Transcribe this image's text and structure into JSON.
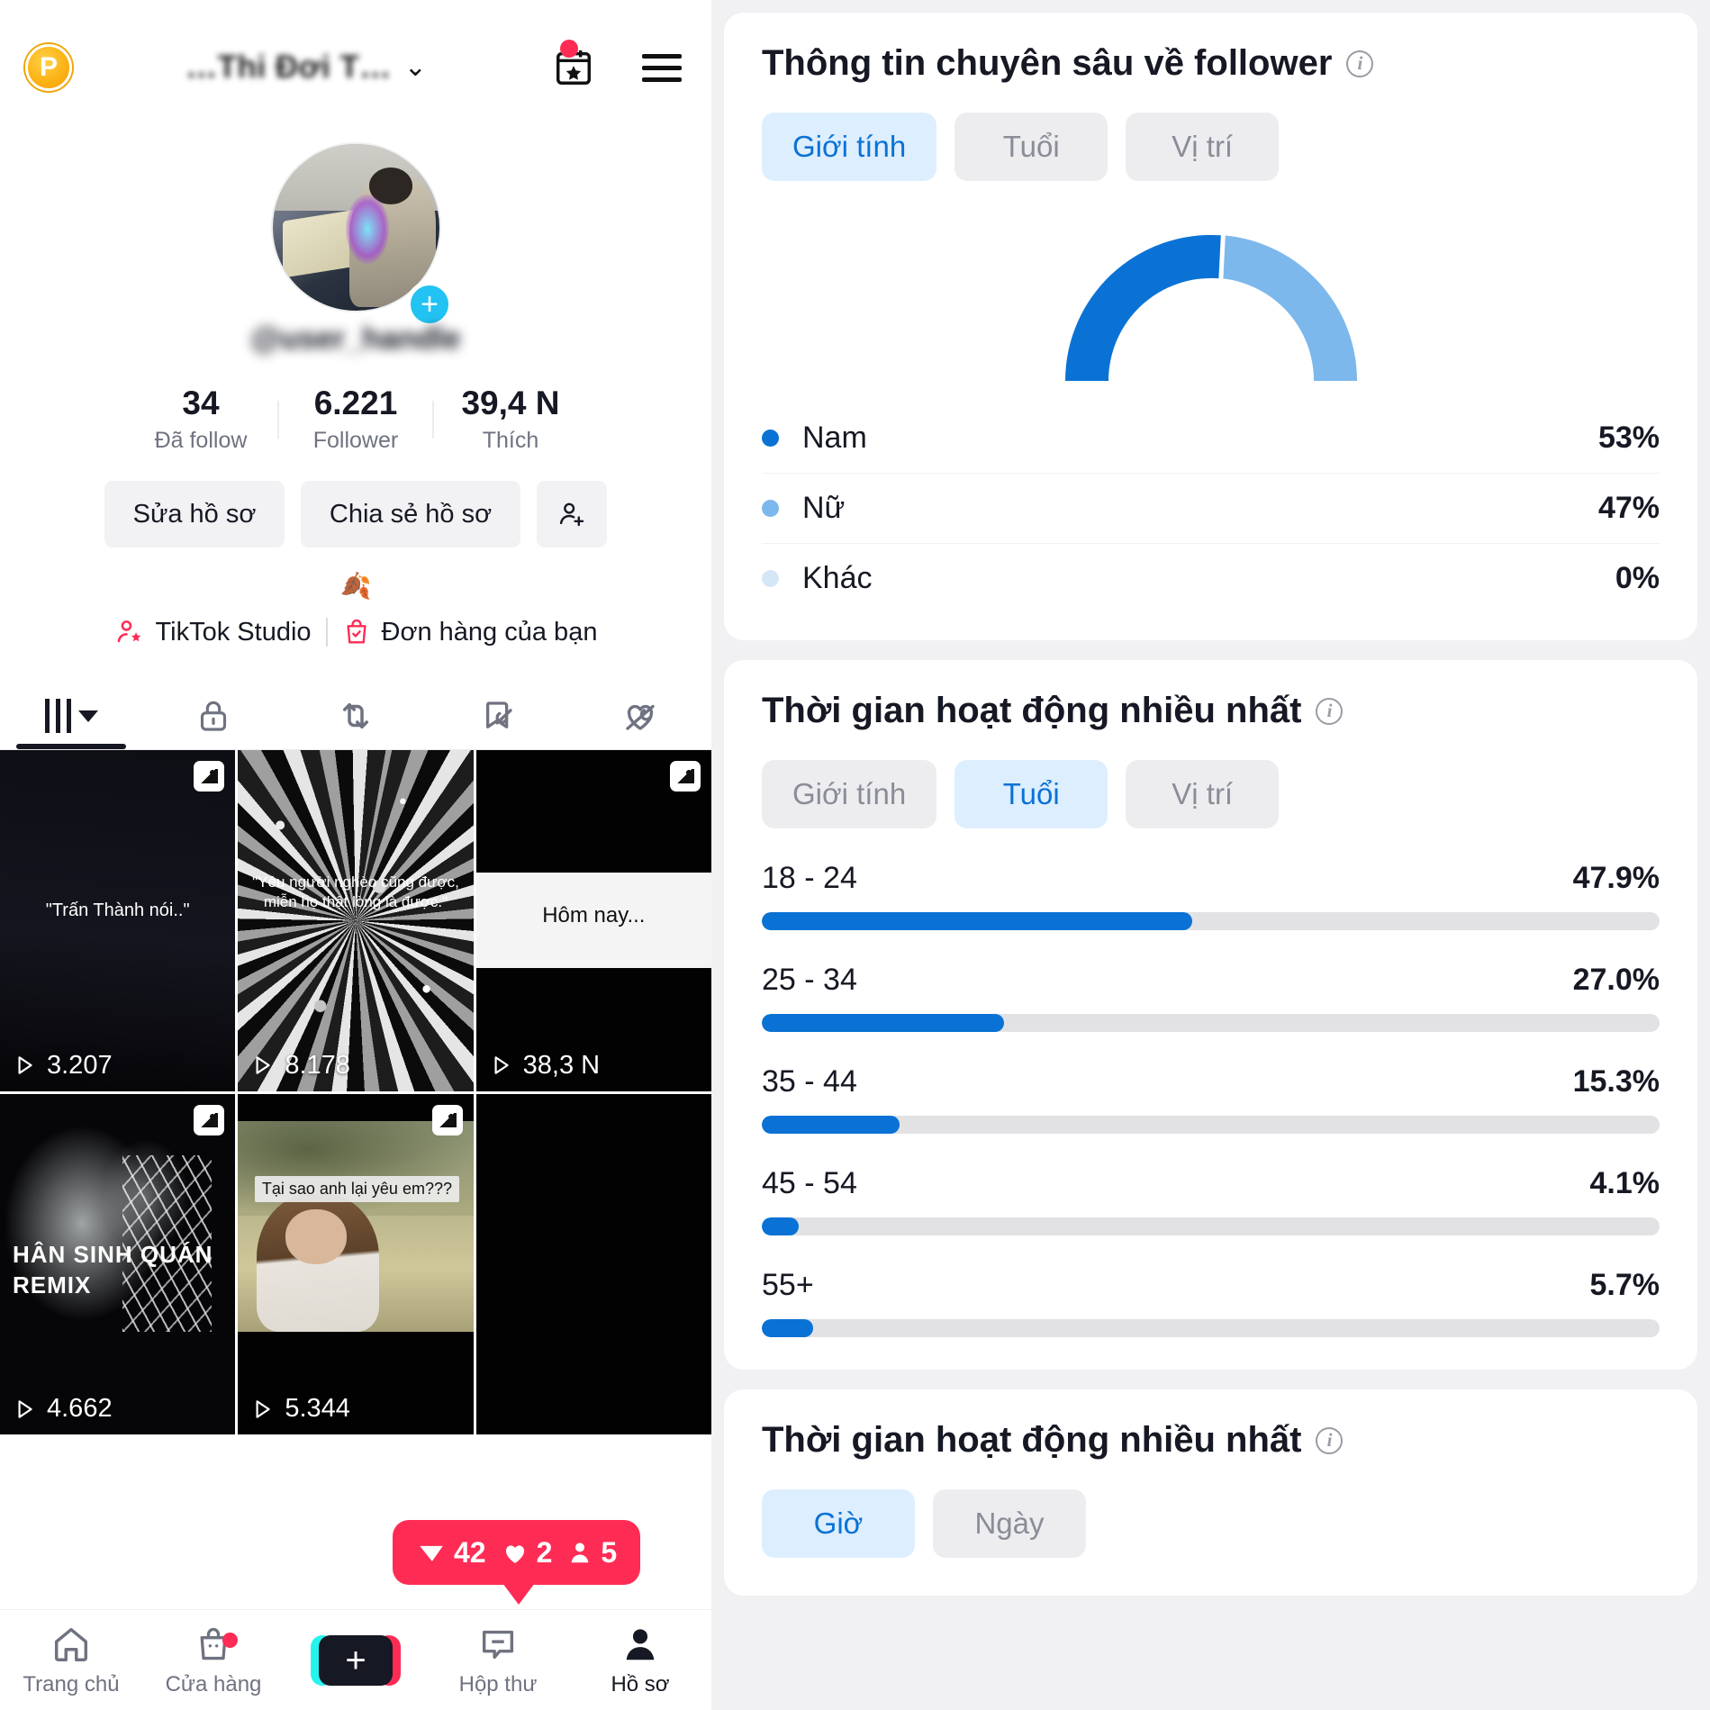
{
  "phone": {
    "header": {
      "pro_badge": "P",
      "title": "…Thi Đơi T…",
      "chevron": "chevron-down",
      "bookmark_star_icon": "bookmark-star-icon",
      "menu_icon": "hamburger-menu-icon"
    },
    "profile": {
      "handle": "@user_handle",
      "add_badge": "+"
    },
    "stats": [
      {
        "value": "34",
        "label": "Đã follow"
      },
      {
        "value": "6.221",
        "label": "Follower"
      },
      {
        "value": "39,4 N",
        "label": "Thích"
      }
    ],
    "actions": {
      "edit": "Sửa hồ sơ",
      "share": "Chia sẻ hồ sơ",
      "add_friend_icon": "add-person-icon"
    },
    "bio": "🍂",
    "links": {
      "studio": "TikTok Studio",
      "orders": "Đơn hàng của bạn"
    },
    "tabs": [
      {
        "name": "grid",
        "active": true
      },
      {
        "name": "private-lock",
        "active": false
      },
      {
        "name": "repost",
        "active": false
      },
      {
        "name": "saved-hidden",
        "active": false
      },
      {
        "name": "liked-hidden",
        "active": false
      }
    ],
    "videos": [
      {
        "views": "3.207",
        "caption": "\"Trấn Thành nói..\"",
        "multi": true
      },
      {
        "views": "8.178",
        "caption": "\"Yêu người nghèo cũng được, miễn họ thật lòng là được.\"",
        "multi": false
      },
      {
        "views": "38,3 N",
        "caption": "Hôm nay...",
        "multi": true
      },
      {
        "views": "4.662",
        "caption": "HÂN SINH QUÁN REMIX",
        "multi": true
      },
      {
        "views": "5.344",
        "caption": "Tại sao anh lại yêu em???",
        "multi": true
      },
      {
        "views": "",
        "caption": "",
        "multi": false
      }
    ],
    "engagement": {
      "shares": "42",
      "likes": "2",
      "followers": "5"
    },
    "bottom_nav": [
      {
        "label": "Trang chủ",
        "icon": "home-icon",
        "active": false,
        "badge": false
      },
      {
        "label": "Cửa hàng",
        "icon": "shop-bag-icon",
        "active": false,
        "badge": true
      },
      {
        "label": "",
        "icon": "create-plus-icon",
        "active": false,
        "badge": false
      },
      {
        "label": "Hộp thư",
        "icon": "inbox-icon",
        "active": false,
        "badge": false
      },
      {
        "label": "Hồ sơ",
        "icon": "profile-person-icon",
        "active": true,
        "badge": false
      }
    ]
  },
  "analytics": {
    "colors": {
      "primary_blue": "#0a72d4",
      "light_blue": "#7db8ec",
      "pale_blue": "#d5e7f7",
      "track_gray": "#e2e2e5",
      "pill_active_bg": "#ddeeff"
    },
    "follower_card": {
      "title": "Thông tin chuyên sâu về follower",
      "info_icon": "info-icon",
      "pills": [
        {
          "label": "Giới tính",
          "active": true
        },
        {
          "label": "Tuổi",
          "active": false
        },
        {
          "label": "Vị trí",
          "active": false
        }
      ]
    },
    "activity_card": {
      "title": "Thời gian hoạt động nhiều nhất",
      "info_icon": "info-icon",
      "pills": [
        {
          "label": "Giới tính",
          "active": false
        },
        {
          "label": "Tuổi",
          "active": true
        },
        {
          "label": "Vị trí",
          "active": false
        }
      ]
    },
    "hours_card": {
      "title": "Thời gian hoạt động nhiều nhất",
      "info_icon": "info-icon",
      "pills": [
        {
          "label": "Giờ",
          "active": true
        },
        {
          "label": "Ngày",
          "active": false
        }
      ]
    }
  },
  "chart_data": [
    {
      "type": "pie",
      "title": "Thông tin chuyên sâu về follower",
      "subtitle": "Giới tính",
      "labels": [
        "Nam",
        "Nữ",
        "Khác"
      ],
      "values": [
        53,
        47,
        0
      ],
      "value_labels": [
        "53%",
        "47%",
        "0%"
      ],
      "colors": [
        "#0a72d4",
        "#7db8ec",
        "#d5e7f7"
      ],
      "legend": "below",
      "note": "semicircle donut gauge"
    },
    {
      "type": "bar",
      "title": "Thời gian hoạt động nhiều nhất",
      "subtitle": "Tuổi",
      "orientation": "horizontal",
      "categories": [
        "18 - 24",
        "25 - 34",
        "35 - 44",
        "45 - 54",
        "55+"
      ],
      "values": [
        47.9,
        27.0,
        15.3,
        4.1,
        5.7
      ],
      "value_labels": [
        "47.9%",
        "27.0%",
        "15.3%",
        "4.1%",
        "5.7%"
      ],
      "xlim": [
        0,
        100
      ],
      "ylabel": "",
      "xlabel": "",
      "grid": false,
      "bar_color": "#0a72d4",
      "track_color": "#e2e2e5"
    }
  ]
}
